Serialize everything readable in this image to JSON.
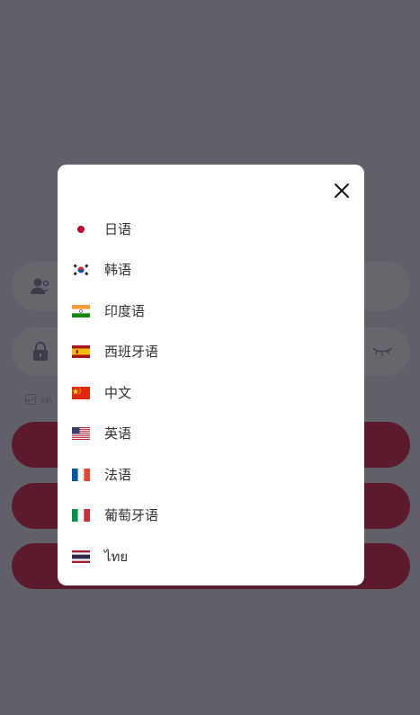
{
  "login_form": {
    "remember_label": "จด"
  },
  "language_modal": {
    "close_icon": "close-icon",
    "languages": [
      {
        "label": "日语",
        "flag": "japan-flag-icon"
      },
      {
        "label": "韩语",
        "flag": "south-korea-flag-icon"
      },
      {
        "label": "印度语",
        "flag": "india-flag-icon"
      },
      {
        "label": "西班牙语",
        "flag": "spain-flag-icon"
      },
      {
        "label": "中文",
        "flag": "china-flag-icon"
      },
      {
        "label": "英语",
        "flag": "usa-flag-icon"
      },
      {
        "label": "法语",
        "flag": "france-flag-icon"
      },
      {
        "label": "葡萄牙语",
        "flag": "italy-flag-icon"
      },
      {
        "label": "ไทย",
        "flag": "thailand-flag-icon"
      }
    ]
  },
  "colors": {
    "overlay": "#00000a",
    "modal_background": "#ffffff",
    "button_accent": "#e7455f",
    "text": "#333333"
  }
}
